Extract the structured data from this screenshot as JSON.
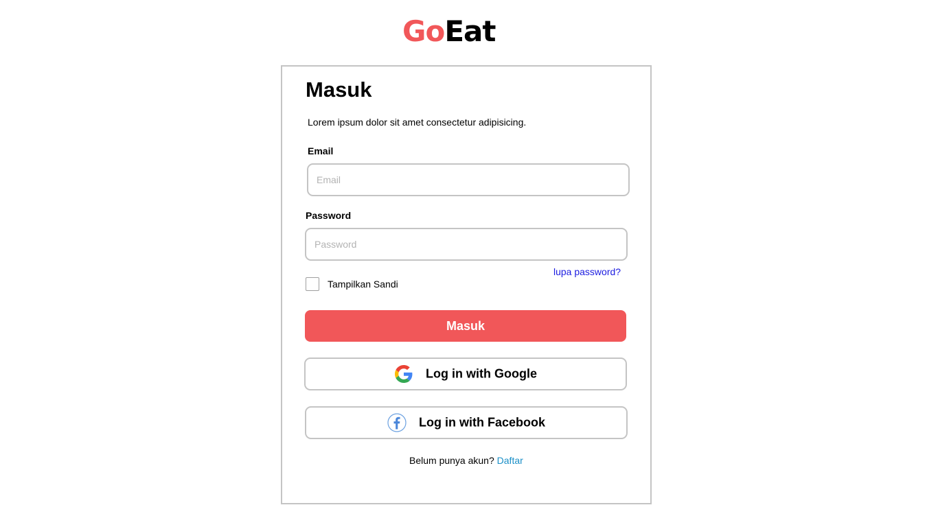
{
  "logo": {
    "part1": "Go",
    "part2": "Eat"
  },
  "login": {
    "title": "Masuk",
    "subtitle": "Lorem ipsum dolor sit amet consectetur adipisicing.",
    "email_label": "Email",
    "email_placeholder": "Email",
    "email_value": "",
    "password_label": "Password",
    "password_placeholder": "Password",
    "password_value": "",
    "forgot_link": "lupa password?",
    "show_password_label": "Tampilkan Sandi",
    "show_password_checked": false,
    "submit_label": "Masuk",
    "google_label": "Log in with Google",
    "facebook_label": "Log in with Facebook",
    "footer_text": "Belum punya akun?",
    "footer_link": "Daftar"
  },
  "icons": {
    "google": "google-icon",
    "facebook": "facebook-icon"
  },
  "colors": {
    "brand": "#f15759",
    "link": "#1a8fc7",
    "forgot_link": "#1a1ae0",
    "border": "#c4c4c4"
  }
}
